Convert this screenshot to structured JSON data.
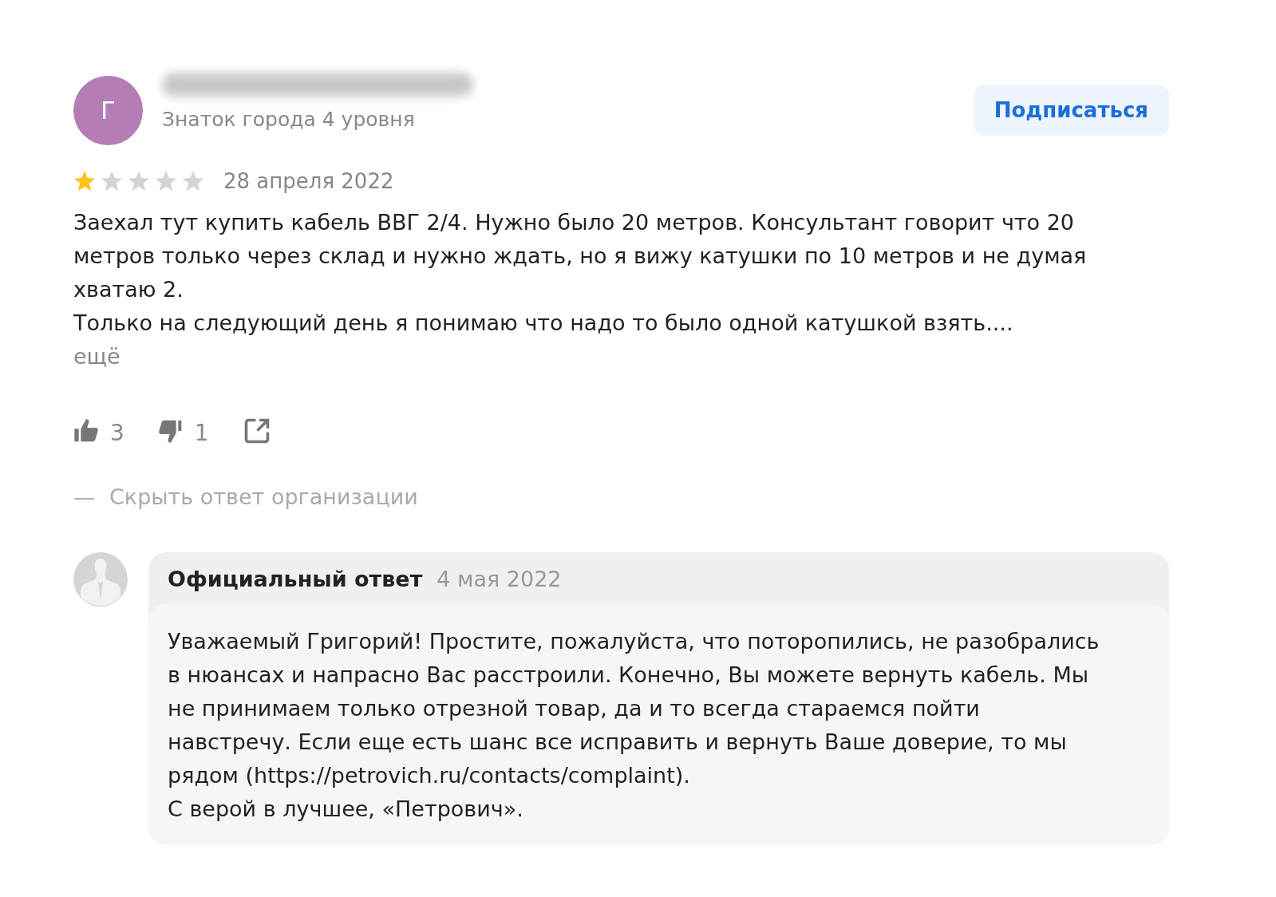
{
  "author": {
    "initial": "Г",
    "level": "Знаток города 4 уровня"
  },
  "subscribe_button": "Подписаться",
  "review": {
    "stars": 1,
    "date": "28 апреля 2022",
    "paragraphs": [
      "Заехал тут купить кабель ВВГ 2/4. Нужно было 20 метров. Консультант говорит что 20 метров только через склад и нужно ждать, но я вижу катушки по 10 метров и не думая хватаю 2.",
      "Только на следующий день я понимаю что надо то было одной катушкой взять...."
    ],
    "more": "ещё"
  },
  "reactions": {
    "likes": "3",
    "dislikes": "1"
  },
  "hide_reply": {
    "dash": "—",
    "label": "Скрыть ответ организации"
  },
  "reply": {
    "title": "Официальный ответ",
    "date": "4 мая 2022",
    "paragraphs": [
      "Уважаемый Григорий! Простите, пожалуйста, что поторопились, не разобрались в нюансах и напрасно Вас расстроили. Конечно, Вы можете вернуть кабель. Мы не принимаем только отрезной товар, да и то всегда стараемся пойти навстречу. Если еще есть шанс все исправить и вернуть Ваше доверие, то мы рядом (https://petrovich.ru/contacts/complaint).",
      "С верой в лучшее, «Петрович»."
    ]
  }
}
